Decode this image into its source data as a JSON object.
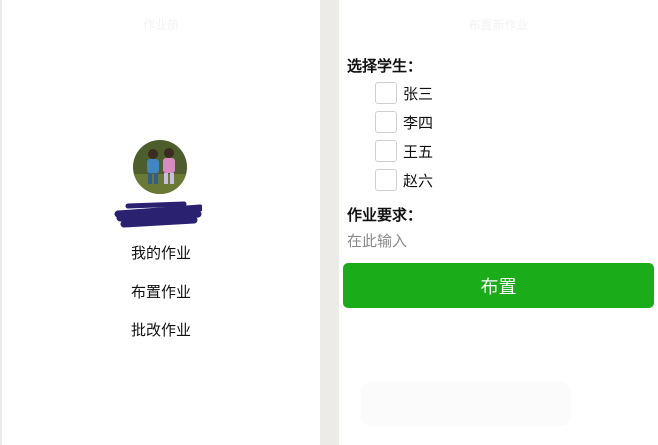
{
  "left_panel": {
    "title": "作业册",
    "menu": [
      {
        "label": "我的作业"
      },
      {
        "label": "布置作业"
      },
      {
        "label": "批改作业"
      }
    ]
  },
  "right_panel": {
    "title": "布置新作业",
    "select_students_label": "选择学生：",
    "students": [
      {
        "name": "张三",
        "checked": false
      },
      {
        "name": "李四",
        "checked": false
      },
      {
        "name": "王五",
        "checked": false
      },
      {
        "name": "赵六",
        "checked": false
      }
    ],
    "requirement_label": "作业要求：",
    "requirement_placeholder": "在此输入",
    "requirement_value": "",
    "submit_label": "布置"
  },
  "colors": {
    "page_background": "#ecebe8",
    "panel_background": "#ffffff",
    "primary_button": "#1aad19",
    "redaction_scribble": "#2a2170"
  }
}
